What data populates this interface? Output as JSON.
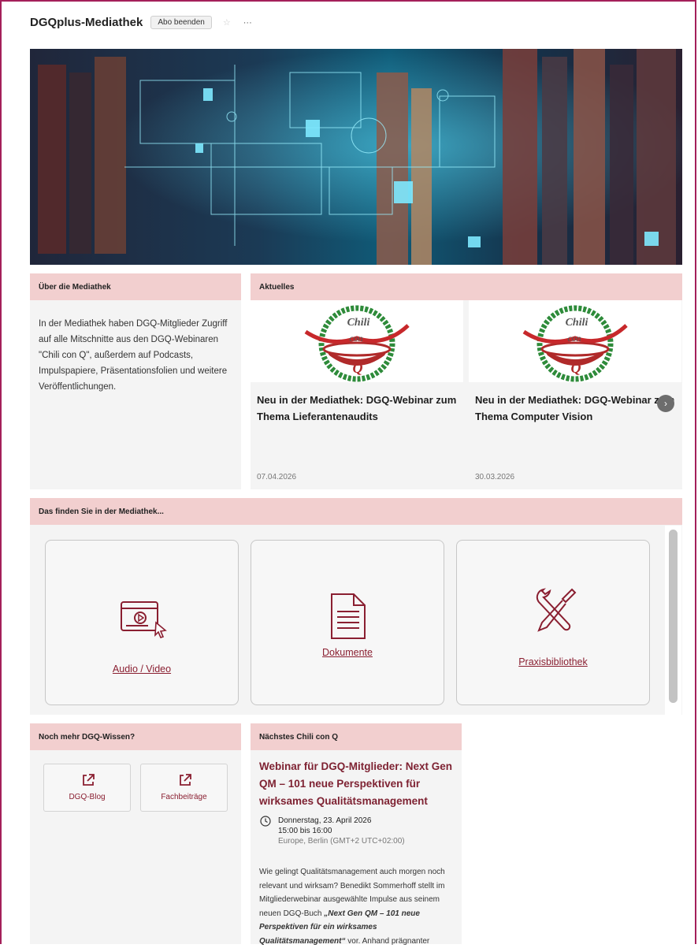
{
  "header": {
    "title": "DGQplus-Mediathek",
    "unsubscribe_label": "Abo beenden",
    "star_icon": "star-icon",
    "more_label": "···"
  },
  "about": {
    "heading": "Über die Mediathek",
    "text": "In der Mediathek haben DGQ-Mitglieder Zugriff auf alle Mitschnitte aus den DGQ-Webinaren \"Chili con Q\", außerdem auf Podcasts, Impulspapiere, Präsentationsfolien und weitere Veröffentlichungen."
  },
  "news": {
    "heading": "Aktuelles",
    "logo_text": [
      "Chili",
      "con",
      "Q"
    ],
    "items": [
      {
        "title": "Neu in der Mediathek: DGQ-Webinar zum Thema Lieferantenaudits",
        "date": "07.04.2026"
      },
      {
        "title": "Neu in der Mediathek: DGQ-Webinar zum Thema Computer Vision",
        "date": "30.03.2026"
      }
    ]
  },
  "contents": {
    "heading": "Das finden Sie in der Mediathek...",
    "tiles": [
      {
        "label": "Audio / Video",
        "icon": "video-player-icon"
      },
      {
        "label": "Dokumente",
        "icon": "document-icon"
      },
      {
        "label": "Praxisbibliothek",
        "icon": "tools-icon"
      }
    ]
  },
  "more": {
    "heading": "Noch mehr DGQ-Wissen?",
    "links": [
      {
        "label": "DGQ-Blog",
        "icon": "external-link-icon"
      },
      {
        "label": "Fachbeiträge",
        "icon": "external-link-icon"
      }
    ]
  },
  "next_event": {
    "heading": "Nächstes Chili con Q",
    "title": "Webinar für DGQ-Mitglieder: Next Gen QM – 101 neue Perspektiven für wirksames Qualitätsmanagement",
    "date": "Donnerstag, 23. April 2026",
    "time": "15:00 bis 16:00",
    "timezone": "Europe, Berlin (GMT+2 UTC+02:00)",
    "body_intro": "Wie gelingt Qualitätsmanagement auch morgen noch relevant und wirksam? Benedikt Sommerhoff stellt im Mitgliederwebinar ausgewählte Impulse aus seinem neuen DGQ-Buch ",
    "body_book": "„Next Gen QM – 101 neue Perspektiven für ein wirksames Qualitätsmanagement“",
    "body_rest": " vor. Anhand prägnanter"
  },
  "colors": {
    "accent": "#8a1f31",
    "panel_head": "#f2cfcf",
    "frame": "#a4205a"
  }
}
